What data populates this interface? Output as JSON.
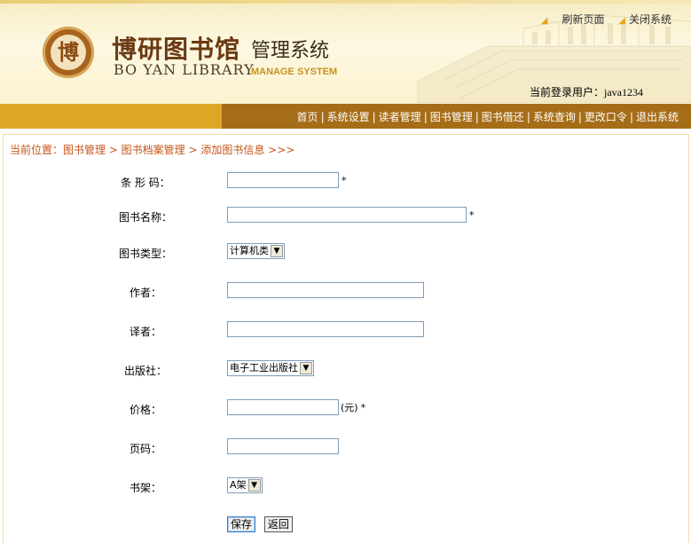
{
  "header": {
    "logo_seal_char": "博",
    "logo_cn": "博研图书馆",
    "logo_sub": "管理系统",
    "logo_en": "BO YAN LIBRARY",
    "logo_en2": "MANAGE SYSTEM",
    "refresh_label": "刷新页面",
    "close_label": "关闭系统",
    "user_prefix": "当前登录用户：",
    "user_name": "java1234"
  },
  "nav": {
    "items": [
      "首页",
      "系统设置",
      "读者管理",
      "图书管理",
      "图书借还",
      "系统查询",
      "更改口令",
      "退出系统"
    ]
  },
  "breadcrumb": "当前位置：图书管理 > 图书档案管理 > 添加图书信息 >>>",
  "form": {
    "barcode": {
      "label": "条 形 码：",
      "value": "",
      "required": "*"
    },
    "book_name": {
      "label": "图书名称：",
      "value": "",
      "required": "*"
    },
    "book_type": {
      "label": "图书类型：",
      "selected": "计算机类"
    },
    "author": {
      "label": "作者：",
      "value": ""
    },
    "translator": {
      "label": "译者：",
      "value": ""
    },
    "publisher": {
      "label": "出版社：",
      "selected": "电子工业出版社"
    },
    "price": {
      "label": "价格：",
      "value": "",
      "unit": "(元)",
      "required": "*"
    },
    "pages": {
      "label": "页码：",
      "value": ""
    },
    "shelf": {
      "label": "书架：",
      "selected": "A架"
    },
    "save_label": "保存",
    "back_label": "返回"
  },
  "colors": {
    "nav_dark": "#a66d18",
    "nav_light": "#dda625",
    "breadcrumb": "#c7541a"
  }
}
